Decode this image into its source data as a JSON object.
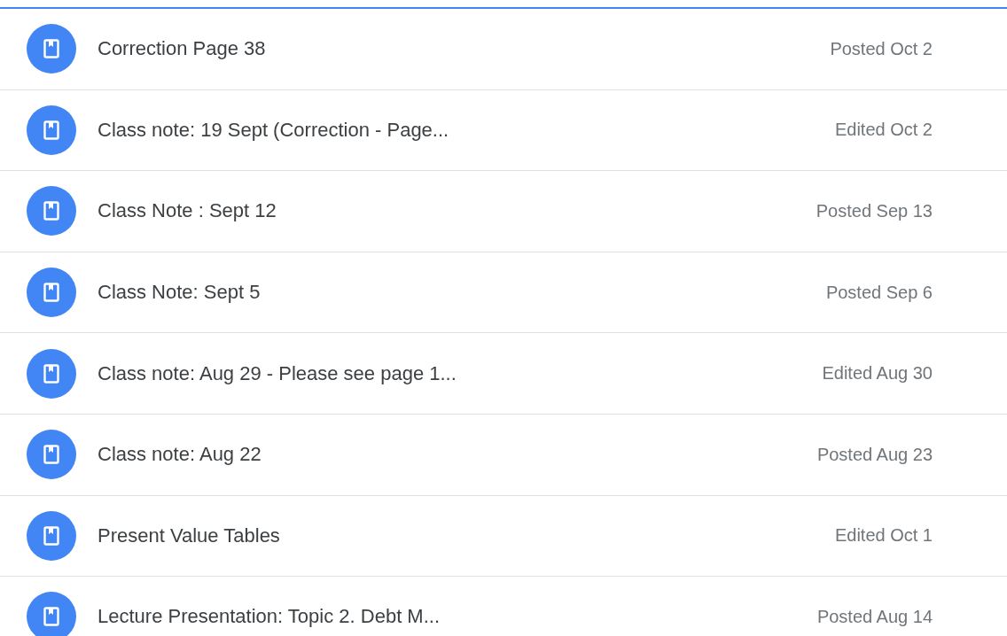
{
  "materials": [
    {
      "title": "Correction Page 38",
      "date": "Posted Oct 2"
    },
    {
      "title": "Class note: 19 Sept (Correction - Page...",
      "date": "Edited Oct 2"
    },
    {
      "title": "Class Note : Sept 12",
      "date": "Posted Sep 13"
    },
    {
      "title": "Class Note: Sept 5",
      "date": "Posted Sep 6"
    },
    {
      "title": "Class note: Aug 29 - Please see page 1...",
      "date": "Edited Aug 30"
    },
    {
      "title": "Class note: Aug 22",
      "date": "Posted Aug 23"
    },
    {
      "title": "Present Value Tables",
      "date": "Edited Oct 1"
    },
    {
      "title": "Lecture Presentation: Topic 2. Debt M...",
      "date": "Posted Aug 14"
    }
  ]
}
